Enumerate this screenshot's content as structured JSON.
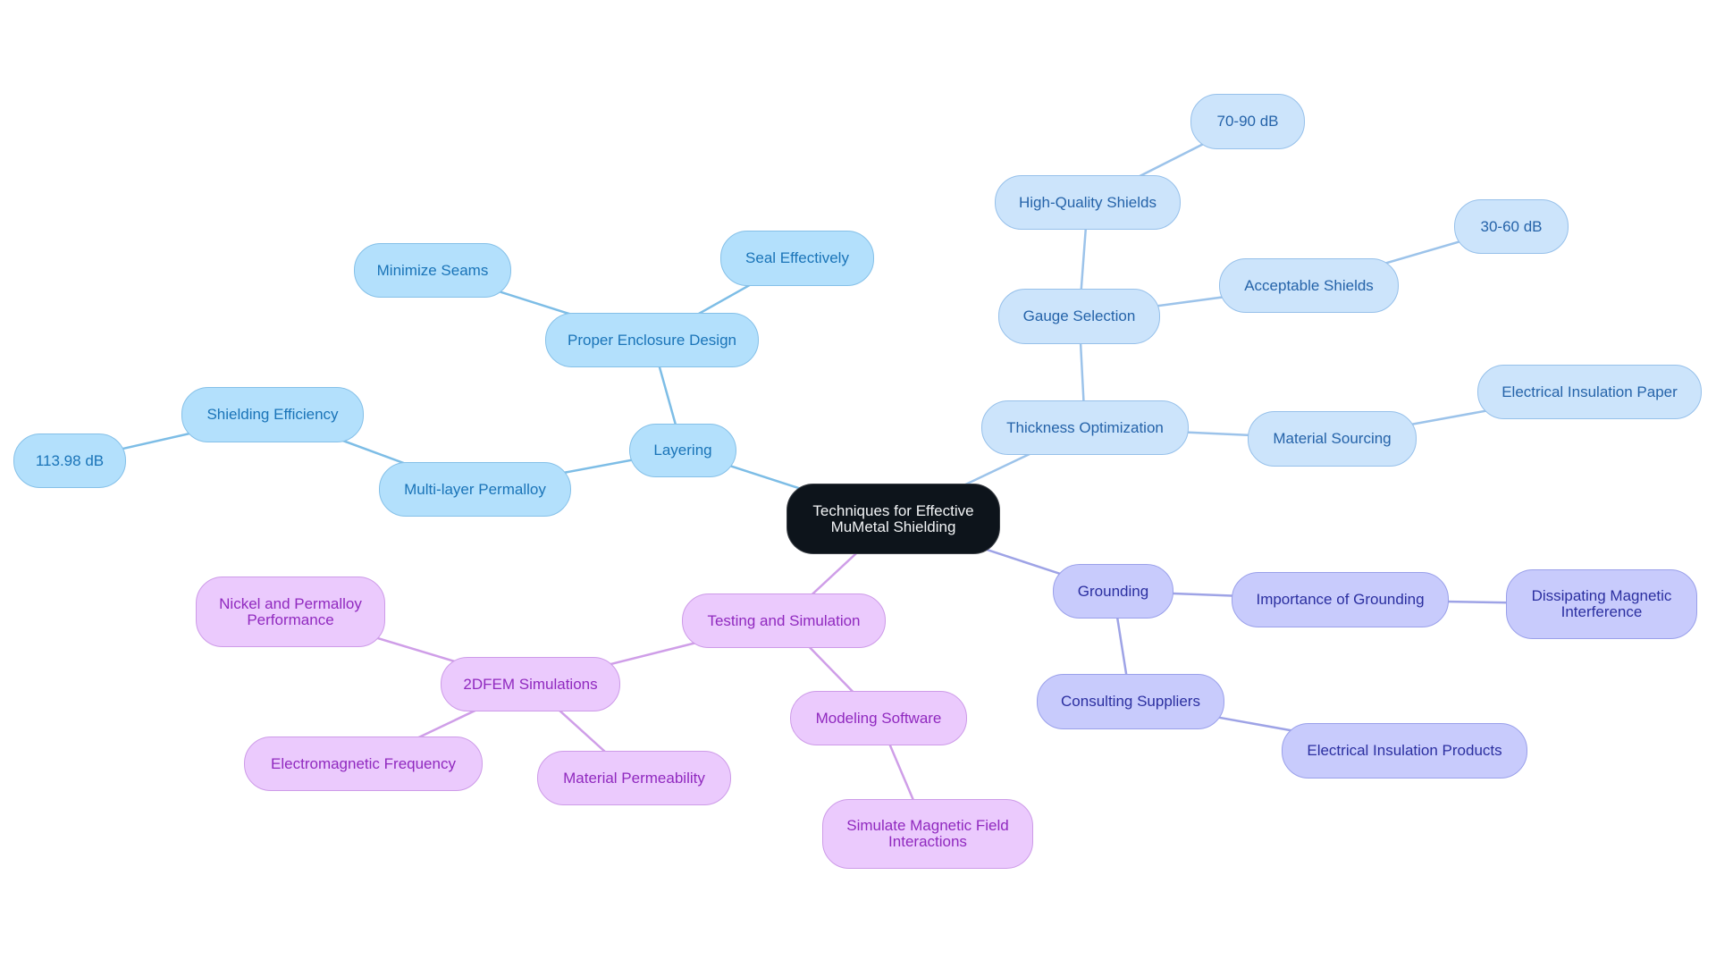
{
  "diagram": {
    "title": "Techniques for Effective MuMetal Shielding",
    "palette": {
      "root_fill": "#0d141b",
      "layering_fill": "#b3e0fc",
      "layering_edge": "#7dbde6",
      "thickness_fill": "#cce4fb",
      "thickness_edge": "#9cc3ea",
      "grounding_fill": "#c8cbfc",
      "grounding_edge": "#9ea3e6",
      "testing_fill": "#ebcafd",
      "testing_edge": "#cf9ee8"
    },
    "nodes": [
      {
        "id": "root",
        "label": "Techniques for Effective MuMetal Shielding",
        "lines": [
          "Techniques for Effective",
          "MuMetal Shielding"
        ],
        "branch": "root"
      },
      {
        "id": "layering",
        "label": "Layering",
        "lines": [
          "Layering"
        ],
        "branch": "layering",
        "parent": "root"
      },
      {
        "id": "proper-enclosure-design",
        "label": "Proper Enclosure Design",
        "lines": [
          "Proper Enclosure Design"
        ],
        "branch": "layering",
        "parent": "layering"
      },
      {
        "id": "minimize-seams",
        "label": "Minimize Seams",
        "lines": [
          "Minimize Seams"
        ],
        "branch": "layering",
        "parent": "proper-enclosure-design"
      },
      {
        "id": "seal-effectively",
        "label": "Seal Effectively",
        "lines": [
          "Seal Effectively"
        ],
        "branch": "layering",
        "parent": "proper-enclosure-design"
      },
      {
        "id": "multi-layer-permalloy",
        "label": "Multi-layer Permalloy",
        "lines": [
          "Multi-layer Permalloy"
        ],
        "branch": "layering",
        "parent": "layering"
      },
      {
        "id": "shielding-efficiency",
        "label": "Shielding Efficiency",
        "lines": [
          "Shielding Efficiency"
        ],
        "branch": "layering",
        "parent": "multi-layer-permalloy"
      },
      {
        "id": "db-113",
        "label": "113.98 dB",
        "lines": [
          "113.98 dB"
        ],
        "branch": "layering",
        "parent": "shielding-efficiency"
      },
      {
        "id": "thickness-optimization",
        "label": "Thickness Optimization",
        "lines": [
          "Thickness Optimization"
        ],
        "branch": "thickness",
        "parent": "root"
      },
      {
        "id": "gauge-selection",
        "label": "Gauge Selection",
        "lines": [
          "Gauge Selection"
        ],
        "branch": "thickness",
        "parent": "thickness-optimization"
      },
      {
        "id": "high-quality-shields",
        "label": "High-Quality Shields",
        "lines": [
          "High-Quality Shields"
        ],
        "branch": "thickness",
        "parent": "gauge-selection"
      },
      {
        "id": "db-70-90",
        "label": "70-90 dB",
        "lines": [
          "70-90 dB"
        ],
        "branch": "thickness",
        "parent": "high-quality-shields"
      },
      {
        "id": "acceptable-shields",
        "label": "Acceptable Shields",
        "lines": [
          "Acceptable Shields"
        ],
        "branch": "thickness",
        "parent": "gauge-selection"
      },
      {
        "id": "db-30-60",
        "label": "30-60 dB",
        "lines": [
          "30-60 dB"
        ],
        "branch": "thickness",
        "parent": "acceptable-shields"
      },
      {
        "id": "material-sourcing",
        "label": "Material Sourcing",
        "lines": [
          "Material Sourcing"
        ],
        "branch": "thickness",
        "parent": "thickness-optimization"
      },
      {
        "id": "electrical-insulation-paper",
        "label": "Electrical Insulation Paper",
        "lines": [
          "Electrical Insulation Paper"
        ],
        "branch": "thickness",
        "parent": "material-sourcing"
      },
      {
        "id": "grounding",
        "label": "Grounding",
        "lines": [
          "Grounding"
        ],
        "branch": "grounding",
        "parent": "root"
      },
      {
        "id": "importance-of-grounding",
        "label": "Importance of Grounding",
        "lines": [
          "Importance of Grounding"
        ],
        "branch": "grounding",
        "parent": "grounding"
      },
      {
        "id": "dissipating-magnetic-interference",
        "label": "Dissipating Magnetic Interference",
        "lines": [
          "Dissipating Magnetic",
          "Interference"
        ],
        "branch": "grounding",
        "parent": "importance-of-grounding"
      },
      {
        "id": "consulting-suppliers",
        "label": "Consulting Suppliers",
        "lines": [
          "Consulting Suppliers"
        ],
        "branch": "grounding",
        "parent": "grounding"
      },
      {
        "id": "electrical-insulation-products",
        "label": "Electrical Insulation Products",
        "lines": [
          "Electrical Insulation Products"
        ],
        "branch": "grounding",
        "parent": "consulting-suppliers"
      },
      {
        "id": "testing-and-simulation",
        "label": "Testing and Simulation",
        "lines": [
          "Testing and Simulation"
        ],
        "branch": "testing",
        "parent": "root"
      },
      {
        "id": "2dfem-simulations",
        "label": "2DFEM Simulations",
        "lines": [
          "2DFEM Simulations"
        ],
        "branch": "testing",
        "parent": "testing-and-simulation"
      },
      {
        "id": "nickel-and-permalloy-performance",
        "label": "Nickel and Permalloy Performance",
        "lines": [
          "Nickel and Permalloy",
          "Performance"
        ],
        "branch": "testing",
        "parent": "2dfem-simulations"
      },
      {
        "id": "electromagnetic-frequency",
        "label": "Electromagnetic Frequency",
        "lines": [
          "Electromagnetic Frequency"
        ],
        "branch": "testing",
        "parent": "2dfem-simulations"
      },
      {
        "id": "material-permeability",
        "label": "Material Permeability",
        "lines": [
          "Material Permeability"
        ],
        "branch": "testing",
        "parent": "2dfem-simulations"
      },
      {
        "id": "modeling-software",
        "label": "Modeling Software",
        "lines": [
          "Modeling Software"
        ],
        "branch": "testing",
        "parent": "testing-and-simulation"
      },
      {
        "id": "simulate-magnetic-field-interactions",
        "label": "Simulate Magnetic Field Interactions",
        "lines": [
          "Simulate Magnetic Field",
          "Interactions"
        ],
        "branch": "testing",
        "parent": "modeling-software"
      }
    ]
  }
}
